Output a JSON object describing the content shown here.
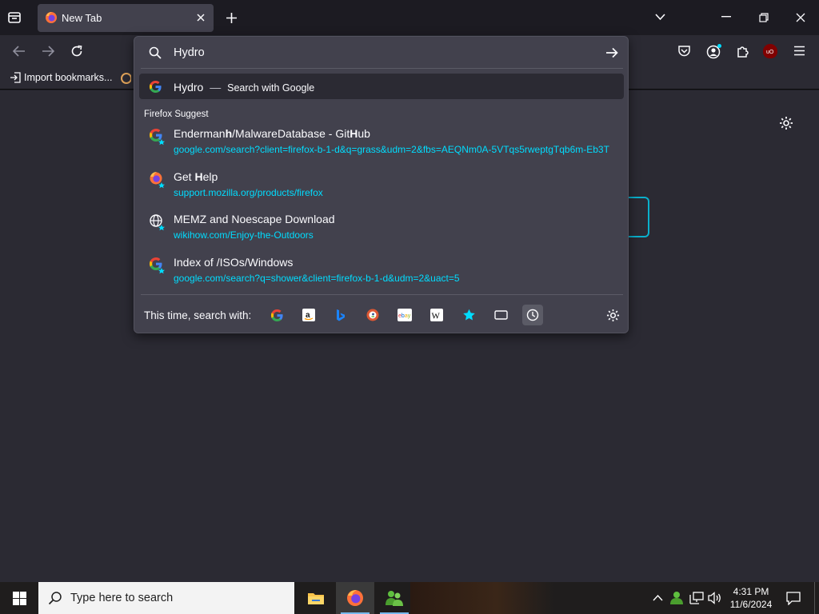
{
  "tab": {
    "title": "New Tab"
  },
  "bookmarks": {
    "import_label": "Import bookmarks..."
  },
  "urlbar": {
    "value": "Hydro",
    "heuristic": {
      "title": "Hydro",
      "dash": "—",
      "action": "Search with Google"
    },
    "group_label": "Firefox Suggest",
    "suggestions": [
      {
        "title_a": "Enderman",
        "title_b": "h",
        "title_c": "/MalwareDatabase - Git",
        "title_d": "H",
        "title_e": "ub",
        "url": "google.com/search?client=firefox-b-1-d&q=grass&udm=2&fbs=AEQNm0A-5VTqs5rweptgTqb6m-Eb3T",
        "icon": "google-icon"
      },
      {
        "title_a": "Get ",
        "title_b": "H",
        "title_c": "elp",
        "url": "support.mozilla.org/products/firefox",
        "icon": "firefox-icon"
      },
      {
        "title": "MEMZ and Noescape Download",
        "url": "wikihow.com/Enjoy-the-Outdoors",
        "icon": "globe-icon"
      },
      {
        "title": "Index of /ISOs/Windows",
        "url": "google.com/search?q=shower&client=firefox-b-1-d&udm=2&uact=5",
        "icon": "google-icon"
      }
    ],
    "one_off_label": "This time, search with:"
  },
  "taskbar": {
    "search_placeholder": "Type here to search",
    "time": "4:31 PM",
    "date": "11/6/2024"
  },
  "colors": {
    "accent": "#00ddff",
    "panel": "#42414d",
    "toolbar": "#2b2a33",
    "frame": "#1c1b22"
  }
}
